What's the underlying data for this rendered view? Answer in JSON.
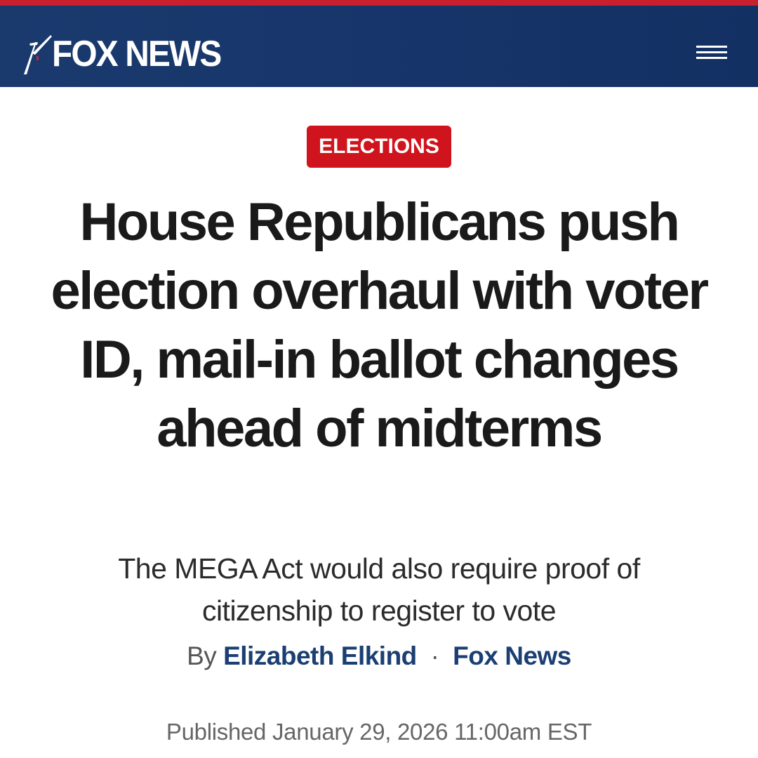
{
  "header": {
    "logo_text": "FOX NEWS",
    "menu_icon": "hamburger-menu-icon"
  },
  "article": {
    "category": "ELECTIONS",
    "headline": "House Republicans push election overhaul with voter ID, mail-in ballot changes ahead of midterms",
    "subheadline": "The MEGA Act would also require proof of citizenship to register to vote",
    "byline": {
      "prefix": "By",
      "author": "Elizabeth Elkind",
      "separator": "·",
      "source": "Fox News"
    },
    "published": "Published January 29, 2026 11:00am EST"
  },
  "colors": {
    "header_bg": "#17356a",
    "top_stripe": "#c8202f",
    "category_bg": "#d0141d",
    "link_blue": "#1b3f73",
    "headline_text": "#1a1a1a"
  }
}
